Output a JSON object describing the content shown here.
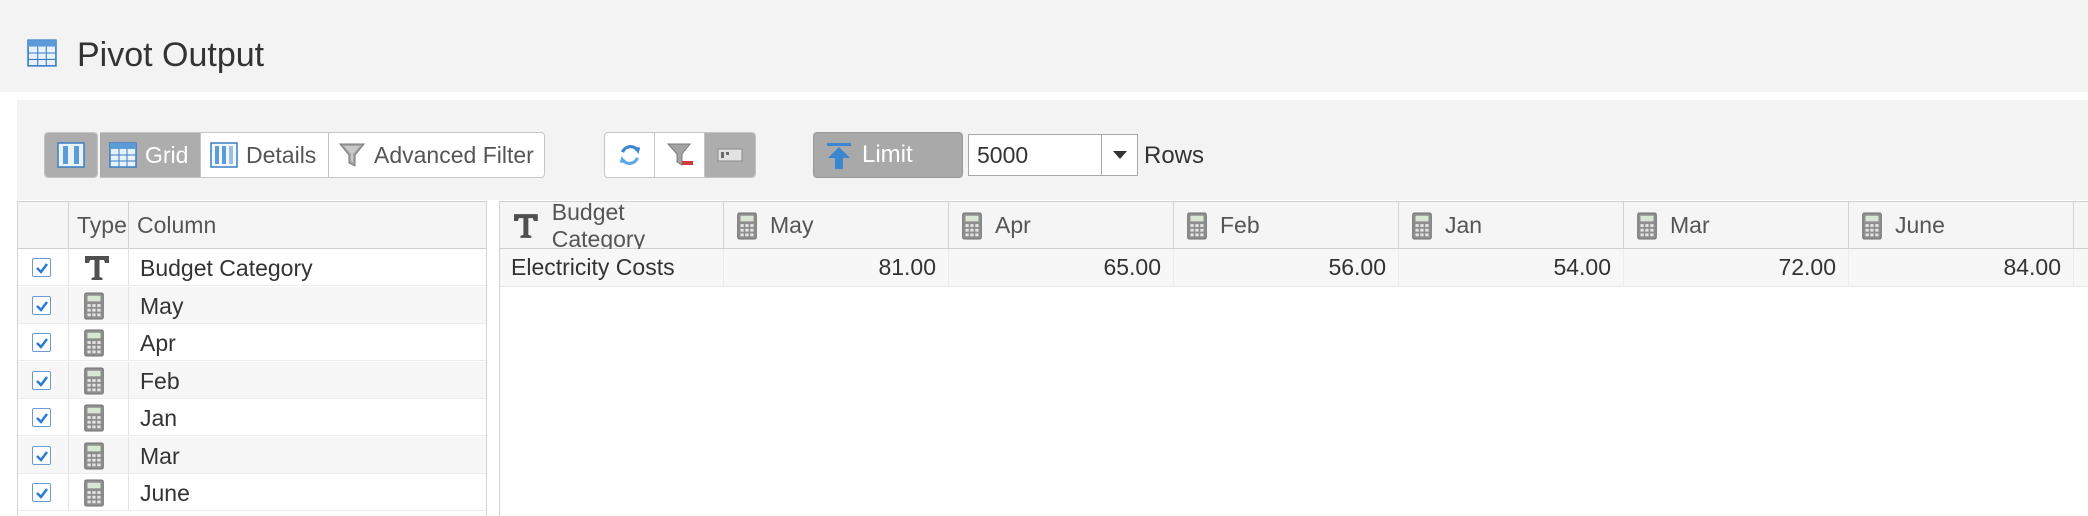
{
  "window": {
    "title": "Pivot Output"
  },
  "toolbar": {
    "view_buttons": [
      {
        "label": "",
        "icon": "column-layout-icon",
        "active": true
      },
      {
        "label": "Grid",
        "icon": "grid-icon",
        "active": true
      },
      {
        "label": "Details",
        "icon": "details-icon",
        "active": false
      },
      {
        "label": "Advanced Filter",
        "icon": "filter-funnel-icon",
        "active": false
      }
    ],
    "action_buttons": [
      {
        "icon": "refresh-icon"
      },
      {
        "icon": "clear-filter-icon"
      },
      {
        "icon": "toggle-panel-icon"
      }
    ],
    "limit_label": "Limit",
    "limit_value": "5000",
    "rows_label": "Rows"
  },
  "columns_panel": {
    "headers": {
      "check": "",
      "type": "Type",
      "column": "Column"
    },
    "rows": [
      {
        "type": "text",
        "name": "Budget Category",
        "checked": true
      },
      {
        "type": "number",
        "name": "May",
        "checked": true
      },
      {
        "type": "number",
        "name": "Apr",
        "checked": true
      },
      {
        "type": "number",
        "name": "Feb",
        "checked": true
      },
      {
        "type": "number",
        "name": "Jan",
        "checked": true
      },
      {
        "type": "number",
        "name": "Mar",
        "checked": true
      },
      {
        "type": "number",
        "name": "June",
        "checked": true
      }
    ]
  },
  "grid": {
    "columns": [
      {
        "name": "Budget Category",
        "type": "text"
      },
      {
        "name": "May",
        "type": "number"
      },
      {
        "name": "Apr",
        "type": "number"
      },
      {
        "name": "Feb",
        "type": "number"
      },
      {
        "name": "Jan",
        "type": "number"
      },
      {
        "name": "Mar",
        "type": "number"
      },
      {
        "name": "June",
        "type": "number"
      }
    ],
    "rows": [
      [
        "Electricity Costs",
        "81.00",
        "65.00",
        "56.00",
        "54.00",
        "72.00",
        "84.00"
      ]
    ]
  },
  "colors": {
    "active_button": "#adadad",
    "checkbox": "#2a7bd6",
    "header_bg": "#f5f5f5"
  }
}
